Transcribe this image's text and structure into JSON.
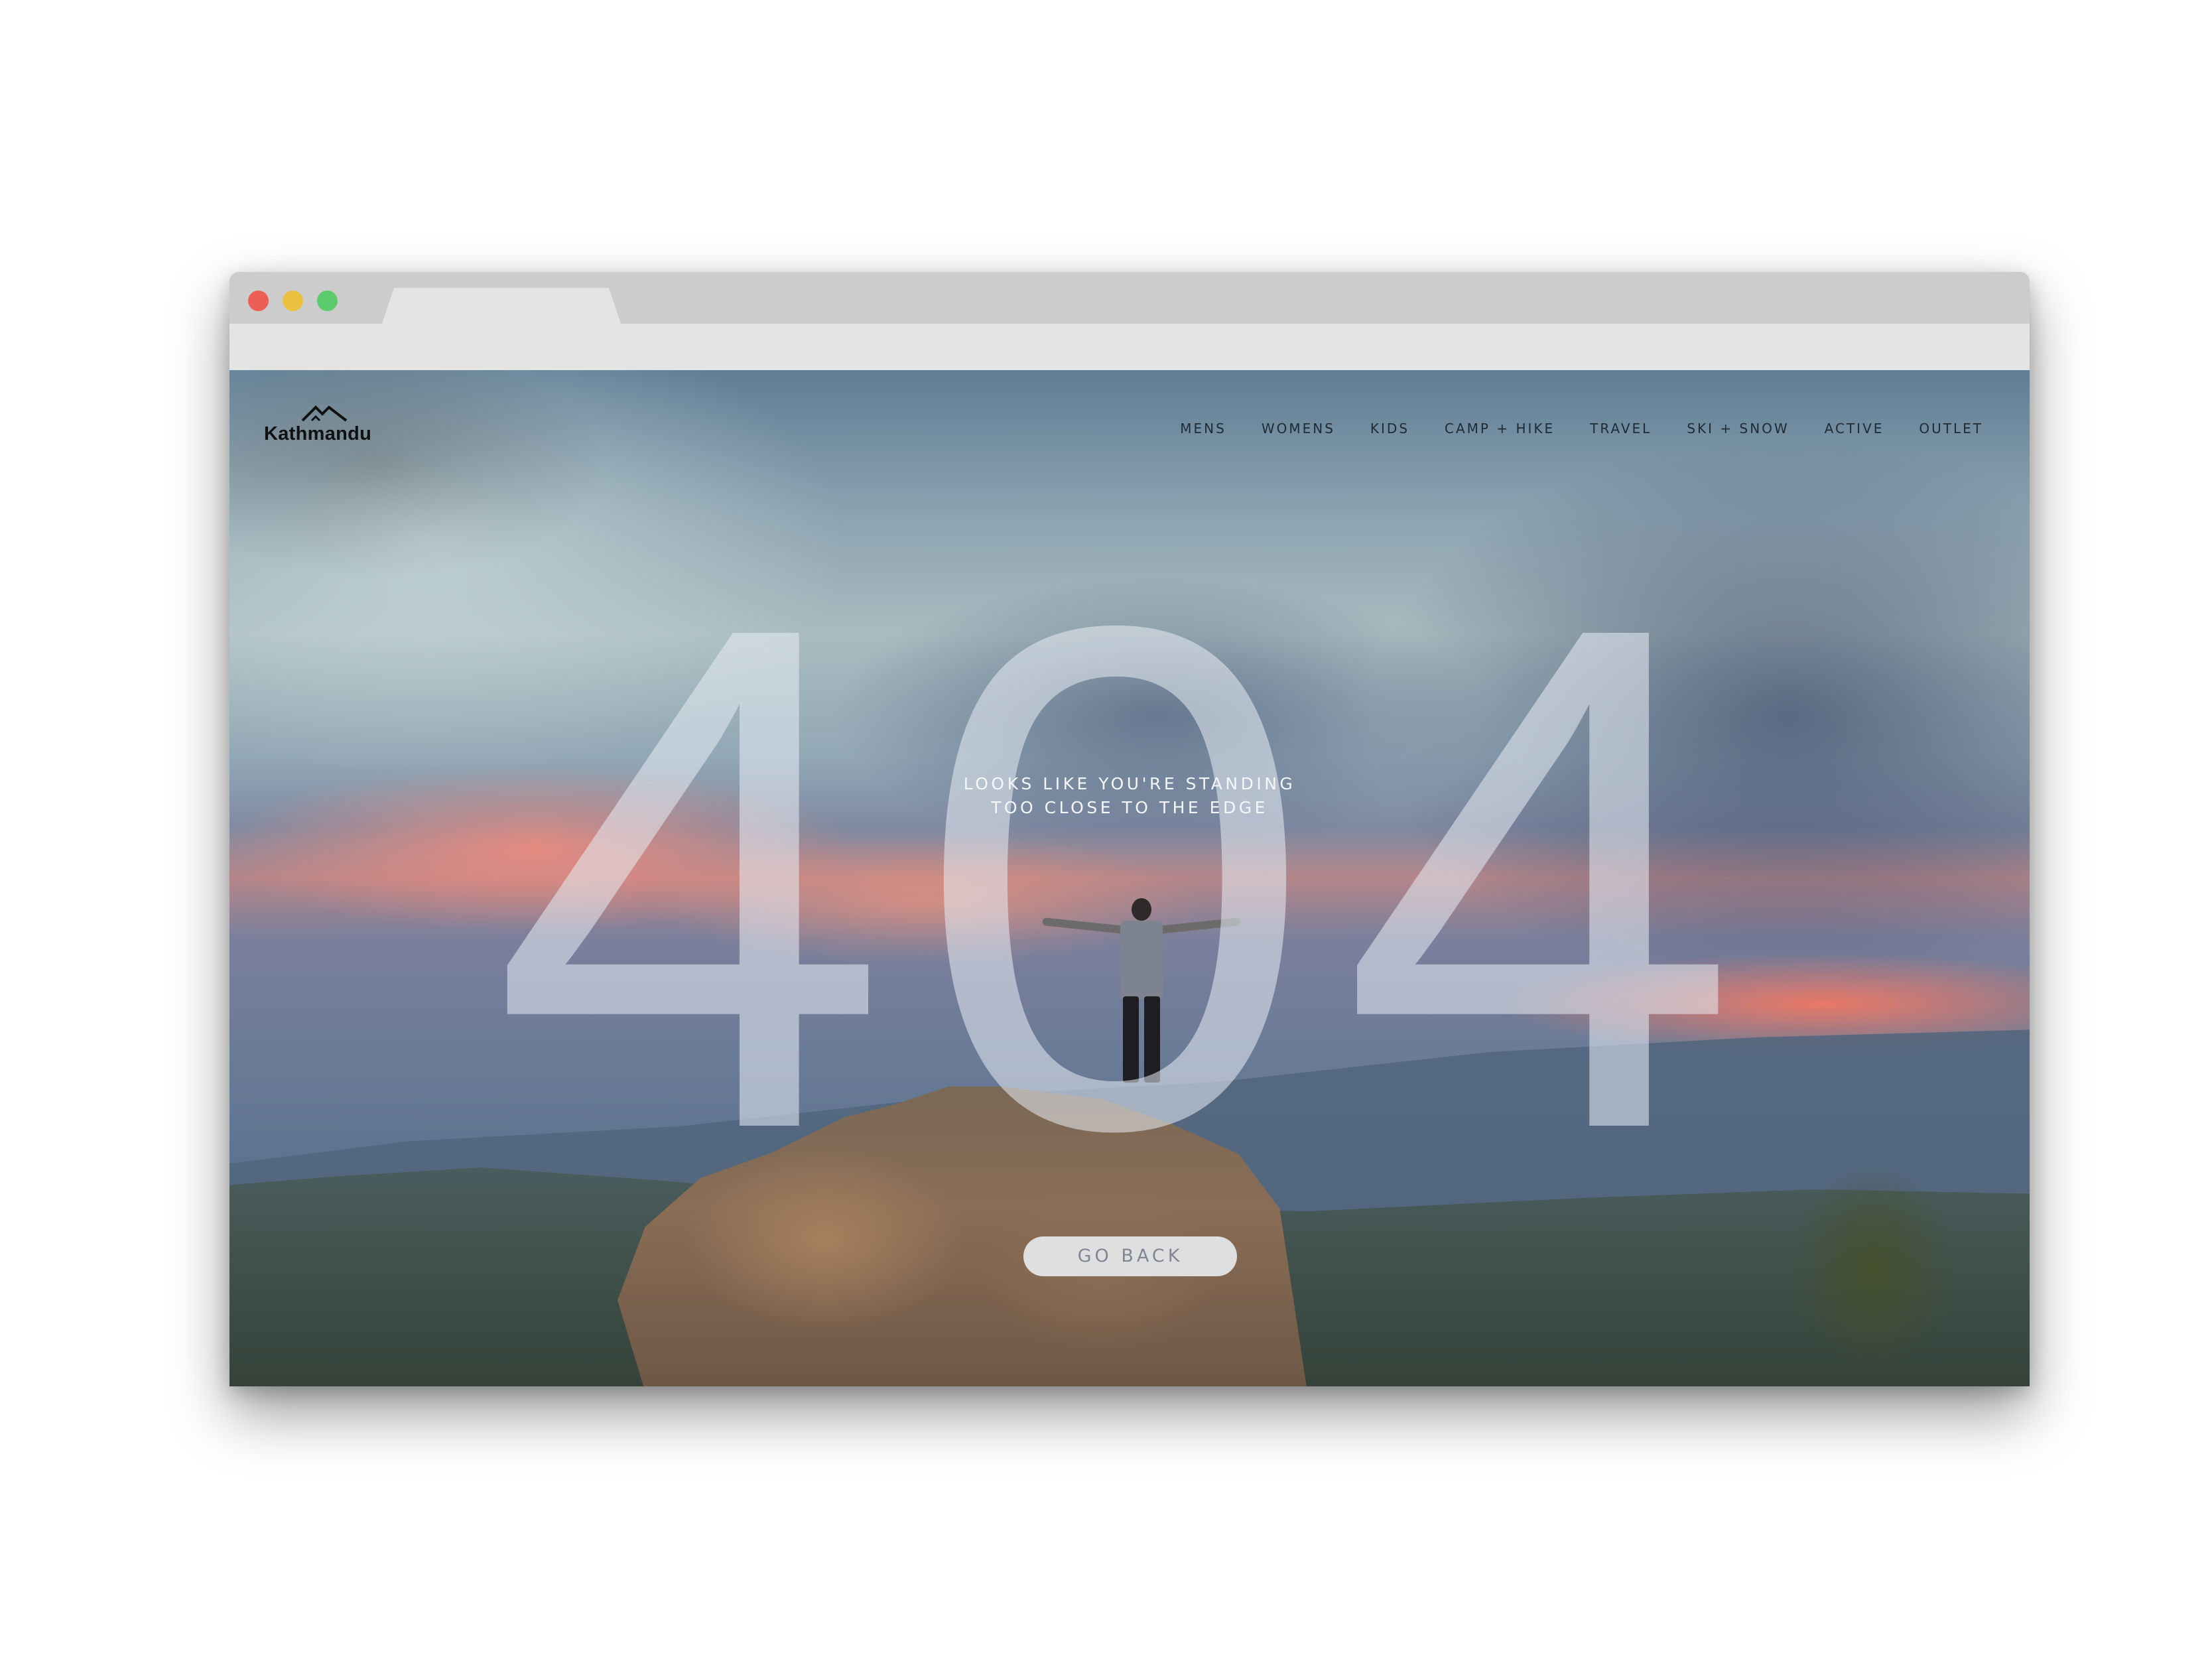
{
  "browser": {
    "window_controls": [
      "close",
      "minimize",
      "maximize"
    ]
  },
  "header": {
    "logo_text": "Kathmandu",
    "logo_icon": "mountain-logo-icon",
    "nav": [
      {
        "label": "MENS"
      },
      {
        "label": "WOMENS"
      },
      {
        "label": "KIDS"
      },
      {
        "label": "CAMP + HIKE"
      },
      {
        "label": "TRAVEL"
      },
      {
        "label": "SKI + SNOW"
      },
      {
        "label": "ACTIVE"
      },
      {
        "label": "OUTLET"
      }
    ]
  },
  "main": {
    "error_code": "404",
    "message_line1": "LOOKS LIKE YOU'RE STANDING",
    "message_line2": "TOO CLOSE TO THE EDGE",
    "cta_label": "GO BACK"
  },
  "colors": {
    "close": "#ec5f57",
    "minimize": "#e9c13e",
    "maximize": "#5ccb6b",
    "nav_text": "#1f2a33",
    "button_text": "#7e8796"
  }
}
